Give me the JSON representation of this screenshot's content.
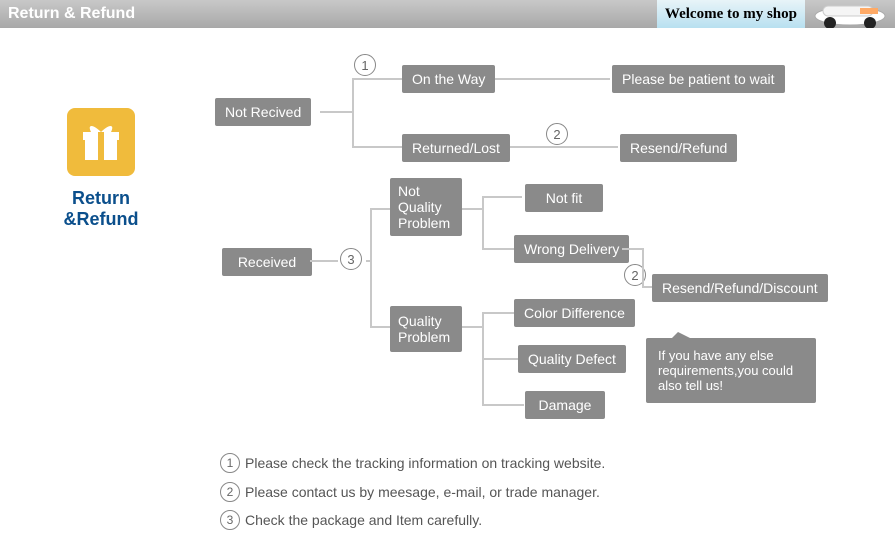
{
  "header": {
    "title": "Return & Refund",
    "welcome": "Welcome to my shop"
  },
  "sidebar": {
    "title": "Return &Refund"
  },
  "flow": {
    "not_received": "Not Recived",
    "received": "Received",
    "on_the_way": "On the Way",
    "returned_lost": "Returned/Lost",
    "not_quality": "Not Quality Problem",
    "quality": "Quality Problem",
    "please_wait": "Please be patient to wait",
    "resend_refund": "Resend/Refund",
    "not_fit": "Not fit",
    "wrong_delivery": "Wrong Delivery",
    "color_diff": "Color Difference",
    "quality_defect": "Quality Defect",
    "damage": "Damage",
    "resend_refund_discount": "Resend/Refund/Discount",
    "speech": "If you have any else requirements,you could also tell us!"
  },
  "circles": {
    "c1": "1",
    "c2": "2",
    "c3": "3"
  },
  "legend": {
    "l1": "Please check the tracking information on tracking website.",
    "l2": "Please contact us by meesage, e-mail, or trade manager.",
    "l3": "Check the package and Item carefully."
  }
}
